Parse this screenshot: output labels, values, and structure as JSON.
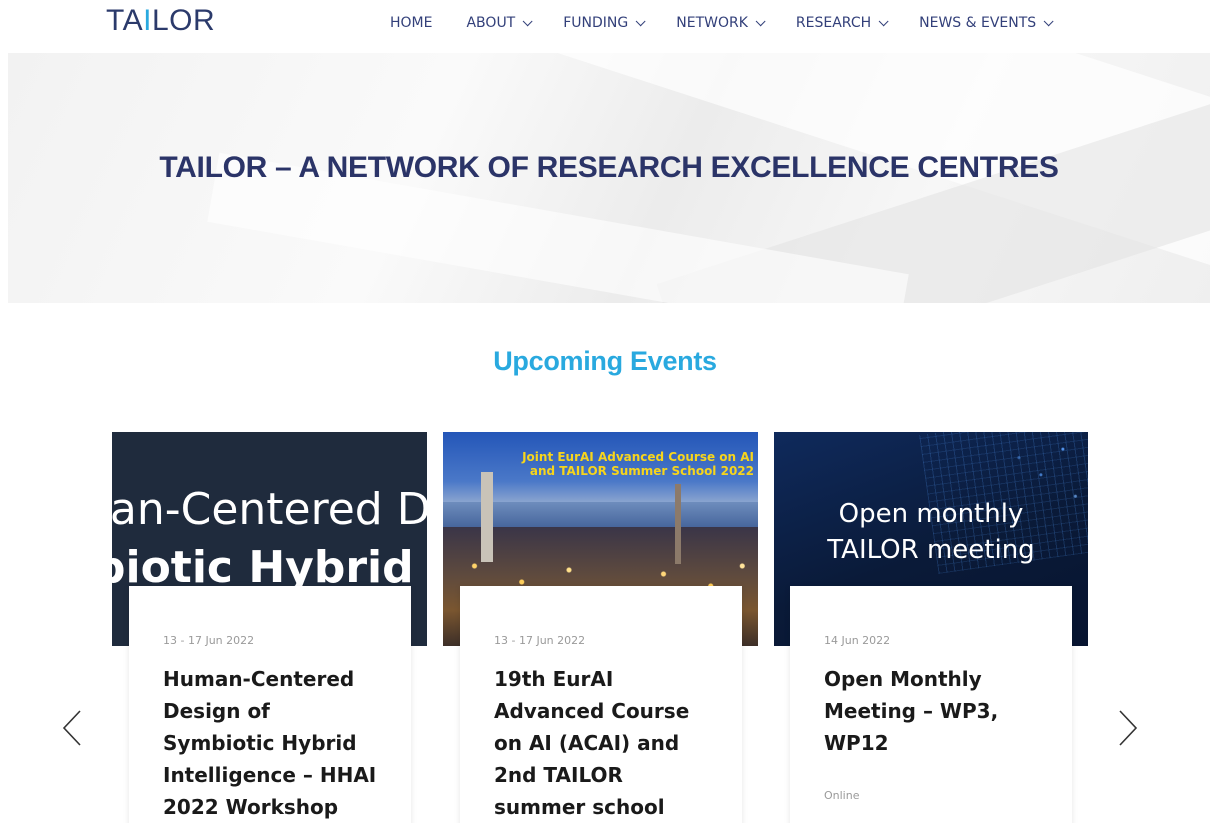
{
  "header": {
    "logo_prefix": "TA",
    "logo_ai": "I",
    "logo_suffix": "LOR",
    "nav": [
      {
        "label": "HOME",
        "has_dropdown": false
      },
      {
        "label": "ABOUT",
        "has_dropdown": true
      },
      {
        "label": "FUNDING",
        "has_dropdown": true
      },
      {
        "label": "NETWORK",
        "has_dropdown": true
      },
      {
        "label": "RESEARCH",
        "has_dropdown": true
      },
      {
        "label": "NEWS & EVENTS",
        "has_dropdown": true
      }
    ]
  },
  "hero": {
    "title": "TAILOR – A NETWORK OF RESEARCH EXCELLENCE CENTRES"
  },
  "events": {
    "heading": "Upcoming Events",
    "items": [
      {
        "image_text_line1": "nan-Centered D",
        "image_text_line2": "biotic Hybrid",
        "date": "13 - 17 Jun 2022",
        "title": "Human-Centered Design of Symbiotic Hybrid Intelligence – HHAI 2022 Workshop",
        "location": ""
      },
      {
        "image_text": "Joint EurAI Advanced Course on AI and TAILOR Summer School 2022",
        "date": "13 - 17 Jun 2022",
        "title": "19th EurAI Advanced Course on AI (ACAI) and 2nd TAILOR summer school",
        "location": ""
      },
      {
        "image_text_line1": "Open monthly",
        "image_text_line2": "TAILOR meeting",
        "date": "14 Jun 2022",
        "title": "Open Monthly Meeting – WP3, WP12",
        "location": "Online"
      }
    ]
  },
  "colors": {
    "brand_navy": "#2b3468",
    "brand_cyan": "#29a9df",
    "event_image_highlight": "#f7d51c"
  }
}
